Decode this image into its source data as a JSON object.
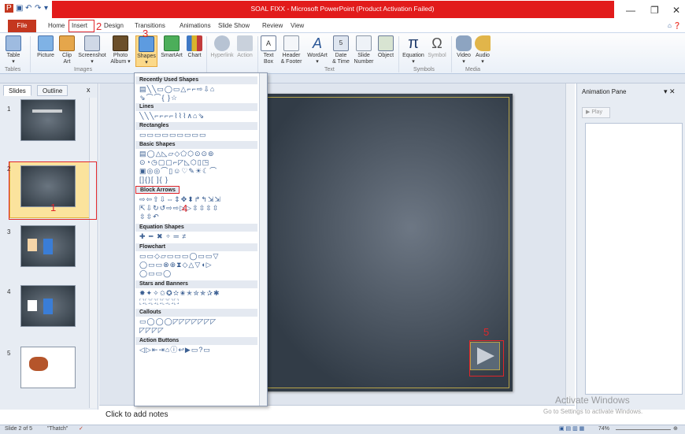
{
  "window": {
    "title": "SOAL FIXX - Microsoft PowerPoint (Product Activation Failed)"
  },
  "tabs": {
    "file": "File",
    "items": [
      "Home",
      "Insert",
      "Design",
      "Transitions",
      "Animations",
      "Slide Show",
      "Review",
      "View"
    ]
  },
  "ribbon": {
    "buttons": [
      {
        "label": "Table\n▾",
        "name": "table-button"
      },
      {
        "label": "Picture",
        "name": "picture-button"
      },
      {
        "label": "Clip\nArt",
        "name": "clip-art-button"
      },
      {
        "label": "Screenshot\n▾",
        "name": "screenshot-button"
      },
      {
        "label": "Photo\nAlbum ▾",
        "name": "photo-album-button"
      },
      {
        "label": "Shapes\n▾",
        "name": "shapes-button"
      },
      {
        "label": "SmartArt",
        "name": "smartart-button"
      },
      {
        "label": "Chart",
        "name": "chart-button"
      },
      {
        "label": "Hyperlink",
        "name": "hyperlink-button"
      },
      {
        "label": "Action",
        "name": "action-button"
      },
      {
        "label": "Text\nBox",
        "name": "text-box-button"
      },
      {
        "label": "Header\n& Footer",
        "name": "header-footer-button"
      },
      {
        "label": "WordArt\n▾",
        "name": "wordart-button"
      },
      {
        "label": "Date\n& Time",
        "name": "date-time-button"
      },
      {
        "label": "Slide\nNumber",
        "name": "slide-number-button"
      },
      {
        "label": "Object",
        "name": "object-button"
      },
      {
        "label": "Equation\n▾",
        "name": "equation-button"
      },
      {
        "label": "Symbol",
        "name": "symbol-button"
      },
      {
        "label": "Video\n▾",
        "name": "video-button"
      },
      {
        "label": "Audio\n▾",
        "name": "audio-button"
      }
    ],
    "groups": [
      "Tables",
      "Images",
      "Text",
      "Symbols",
      "Media"
    ]
  },
  "left_pane": {
    "tabs": [
      "Slides",
      "Outline"
    ],
    "close": "x",
    "slide_numbers": [
      "1",
      "2",
      "3",
      "4",
      "5"
    ]
  },
  "shapes_menu": {
    "categories": [
      {
        "title": "Recently Used Shapes",
        "glyphs": [
          "▤╲╲▭◯▭△⌐⌐⇨⇩⌂",
          "⇘⌒⌒{ }☆"
        ]
      },
      {
        "title": "Lines",
        "glyphs": [
          "╲╲╲⌐⌐⌐⌐⌇⌇⌇∧⌂⇘"
        ]
      },
      {
        "title": "Rectangles",
        "glyphs": [
          "▭▭▭▭▭▭▭▭▭"
        ]
      },
      {
        "title": "Basic Shapes",
        "glyphs": [
          "▤◯△◺▱◇⬠⬡⊙⊙⊚",
          "⊙◔◷▢▢⌐◸◺⬡▯◳",
          "▣◎◎⌒▯☺♡✎☀☾⌒",
          "[]{}[ ]{ }"
        ]
      },
      {
        "title": "Block Arrows",
        "glyphs": [
          "⇨⇦⇧⇩⇔⇕✥⬍↱↰⇲⇲",
          "⇱⇩↻↺⇨⇨▷▷⇳⇳⇳⇳",
          "⇳⇳↶"
        ]
      },
      {
        "title": "Equation Shapes",
        "glyphs": [
          "✚ ━ ✖ ÷ ═ ≠"
        ]
      },
      {
        "title": "Flowchart",
        "glyphs": [
          "▭▭◇▱▭▭▭◯▭▭▽",
          "◯▭▭⊗⊕⧗◇△▽◖▷",
          "◯▭▭◯"
        ]
      },
      {
        "title": "Stars and Banners",
        "glyphs": [
          "✸✦✧✩✪✫✬✭✮✯✰✱",
          "⛶⛶⛶⛶⛶⛶⛶"
        ]
      },
      {
        "title": "Callouts",
        "glyphs": [
          "▭◯◯◯◸◸◸◸◸◸◸",
          "◸◸◸◸"
        ]
      },
      {
        "title": "Action Buttons",
        "glyphs": [
          "◁▷⇤⇥⌂ⓘ↩▶▭?▭"
        ]
      }
    ]
  },
  "annotations": [
    "1",
    "2",
    "3",
    "4",
    "5"
  ],
  "animation_pane": {
    "title": "Animation Pane",
    "play": "Play"
  },
  "notes": {
    "placeholder": "Click to add notes"
  },
  "status": {
    "slide_info": "Slide 2 of 5",
    "theme": "\"Thatch\"",
    "zoom": "74%",
    "activate_title": "Activate Windows",
    "activate_sub": "Go to Settings to activate Windows."
  }
}
